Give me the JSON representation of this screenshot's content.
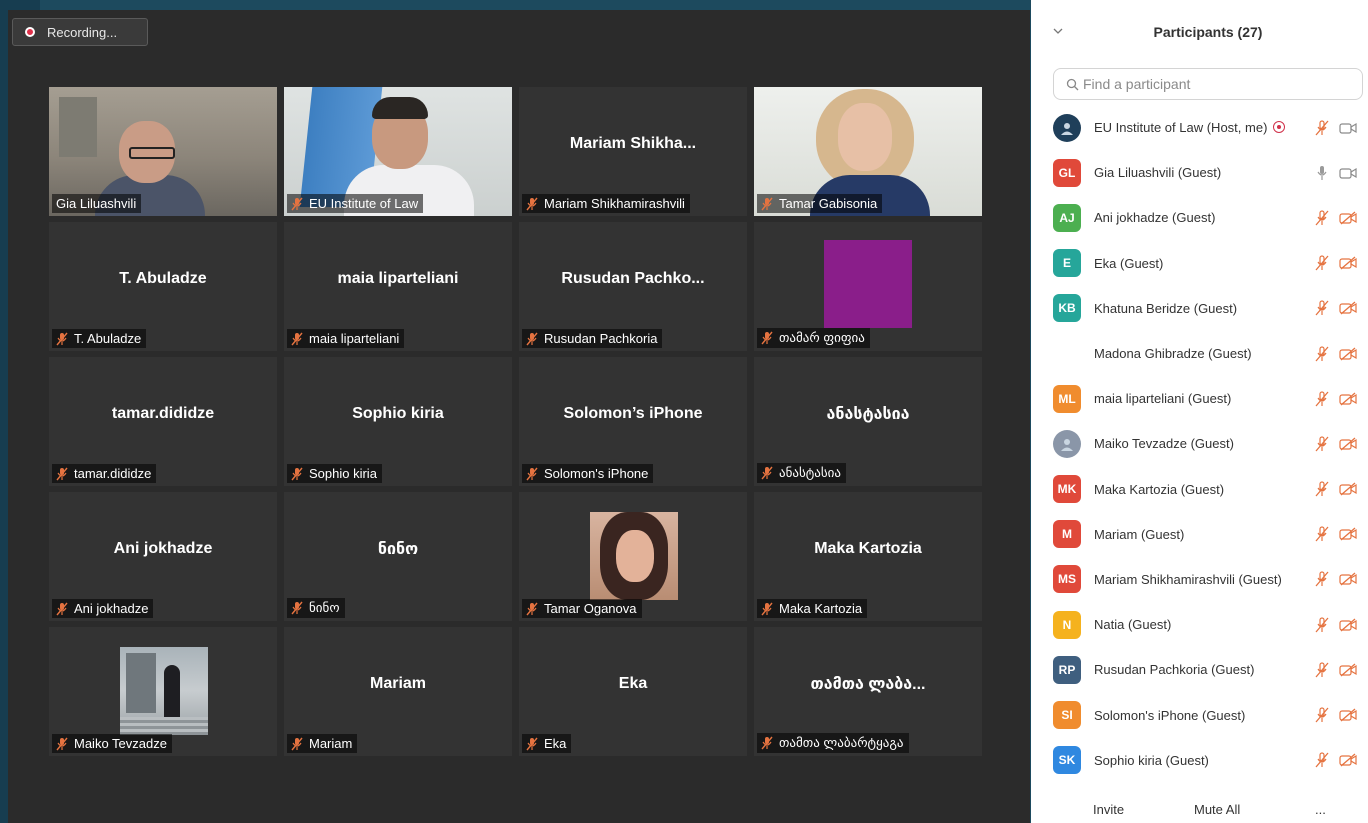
{
  "recording": {
    "label": "Recording..."
  },
  "tiles": [
    {
      "name": "",
      "label": "Gia Liluashvili",
      "muted": false,
      "photo": "office",
      "active": true
    },
    {
      "name": "",
      "label": "EU Institute of Law",
      "muted": true,
      "photo": "flag"
    },
    {
      "name": "Mariam  Shikha...",
      "label": "Mariam Shikhamirashvili",
      "muted": true
    },
    {
      "name": "",
      "label": "Tamar Gabisonia",
      "muted": true,
      "photo": "woman"
    },
    {
      "name": "T. Abuladze",
      "label": "T. Abuladze",
      "muted": true
    },
    {
      "name": "maia liparteliani",
      "label": "maia liparteliani",
      "muted": true
    },
    {
      "name": "Rusudan  Pachko...",
      "label": "Rusudan Pachkoria",
      "muted": true
    },
    {
      "name": "",
      "label": "თამარ ფიფია",
      "muted": true,
      "photo": "square"
    },
    {
      "name": "tamar.dididze",
      "label": "tamar.dididze",
      "muted": true
    },
    {
      "name": "Sophio kiria",
      "label": "Sophio kiria",
      "muted": true
    },
    {
      "name": "Solomon’s iPhone",
      "label": "Solomon's iPhone",
      "muted": true
    },
    {
      "name": "ანასტასია",
      "label": "ანასტასია",
      "muted": true
    },
    {
      "name": "Ani jokhadze",
      "label": "Ani jokhadze",
      "muted": true
    },
    {
      "name": "ნინო",
      "label": "ნინო",
      "muted": true
    },
    {
      "name": "",
      "label": "Tamar Oganova",
      "muted": true,
      "photo": "portrait"
    },
    {
      "name": "Maka Kartozia",
      "label": "Maka Kartozia",
      "muted": true
    },
    {
      "name": "",
      "label": "Maiko Tevzadze",
      "muted": true,
      "photo": "street"
    },
    {
      "name": "Mariam",
      "label": "Mariam",
      "muted": true
    },
    {
      "name": "Eka",
      "label": "Eka",
      "muted": true
    },
    {
      "name": "თამთა ლაბა...",
      "label": "თამთა ლაბარტყაგა",
      "muted": true
    }
  ],
  "panel": {
    "title": "Participants (27)",
    "search_placeholder": "Find a participant",
    "participants": [
      {
        "initials": "",
        "name": "EU Institute of Law (Host, me)",
        "color": "#1f3f5a",
        "image": true,
        "host": true,
        "mic": "muted",
        "cam": "on"
      },
      {
        "initials": "GL",
        "name": "Gia Liluashvili (Guest)",
        "color": "#e0493a",
        "mic": "on",
        "cam": "on"
      },
      {
        "initials": "AJ",
        "name": "Ani jokhadze (Guest)",
        "color": "#4caf50",
        "mic": "muted",
        "cam": "off"
      },
      {
        "initials": "E",
        "name": "Eka (Guest)",
        "color": "#26a69a",
        "mic": "muted",
        "cam": "off"
      },
      {
        "initials": "KB",
        "name": "Khatuna Beridze (Guest)",
        "color": "#26a69a",
        "mic": "muted",
        "cam": "off"
      },
      {
        "initials": "",
        "name": "Madona Ghibradze (Guest)",
        "color": "#ffffff",
        "mic": "muted",
        "cam": "off"
      },
      {
        "initials": "ML",
        "name": "maia liparteliani (Guest)",
        "color": "#f08c2e",
        "mic": "muted",
        "cam": "off"
      },
      {
        "initials": "",
        "name": "Maiko Tevzadze (Guest)",
        "color": "#8a96a8",
        "image": true,
        "mic": "muted",
        "cam": "off"
      },
      {
        "initials": "MK",
        "name": "Maka Kartozia (Guest)",
        "color": "#e0493a",
        "mic": "muted",
        "cam": "off"
      },
      {
        "initials": "M",
        "name": "Mariam (Guest)",
        "color": "#e0493a",
        "mic": "muted",
        "cam": "off"
      },
      {
        "initials": "MS",
        "name": "Mariam Shikhamirashvili (Guest)",
        "color": "#e0493a",
        "mic": "muted",
        "cam": "off"
      },
      {
        "initials": "N",
        "name": "Natia (Guest)",
        "color": "#f5b21e",
        "mic": "muted",
        "cam": "off"
      },
      {
        "initials": "RP",
        "name": "Rusudan Pachkoria (Guest)",
        "color": "#3f5f7f",
        "mic": "muted",
        "cam": "off"
      },
      {
        "initials": "SI",
        "name": "Solomon's iPhone (Guest)",
        "color": "#f08c2e",
        "mic": "muted",
        "cam": "off"
      },
      {
        "initials": "SK",
        "name": "Sophio kiria (Guest)",
        "color": "#2f88e0",
        "mic": "muted",
        "cam": "off"
      }
    ],
    "footer": {
      "invite": "Invite",
      "mute_all": "Mute All",
      "more": "..."
    }
  },
  "colors": {
    "accent_muted": "#e57340",
    "active_border": "#f0dc6a",
    "meeting_bg": "#2b2b2b",
    "tile_bg": "#333333"
  }
}
